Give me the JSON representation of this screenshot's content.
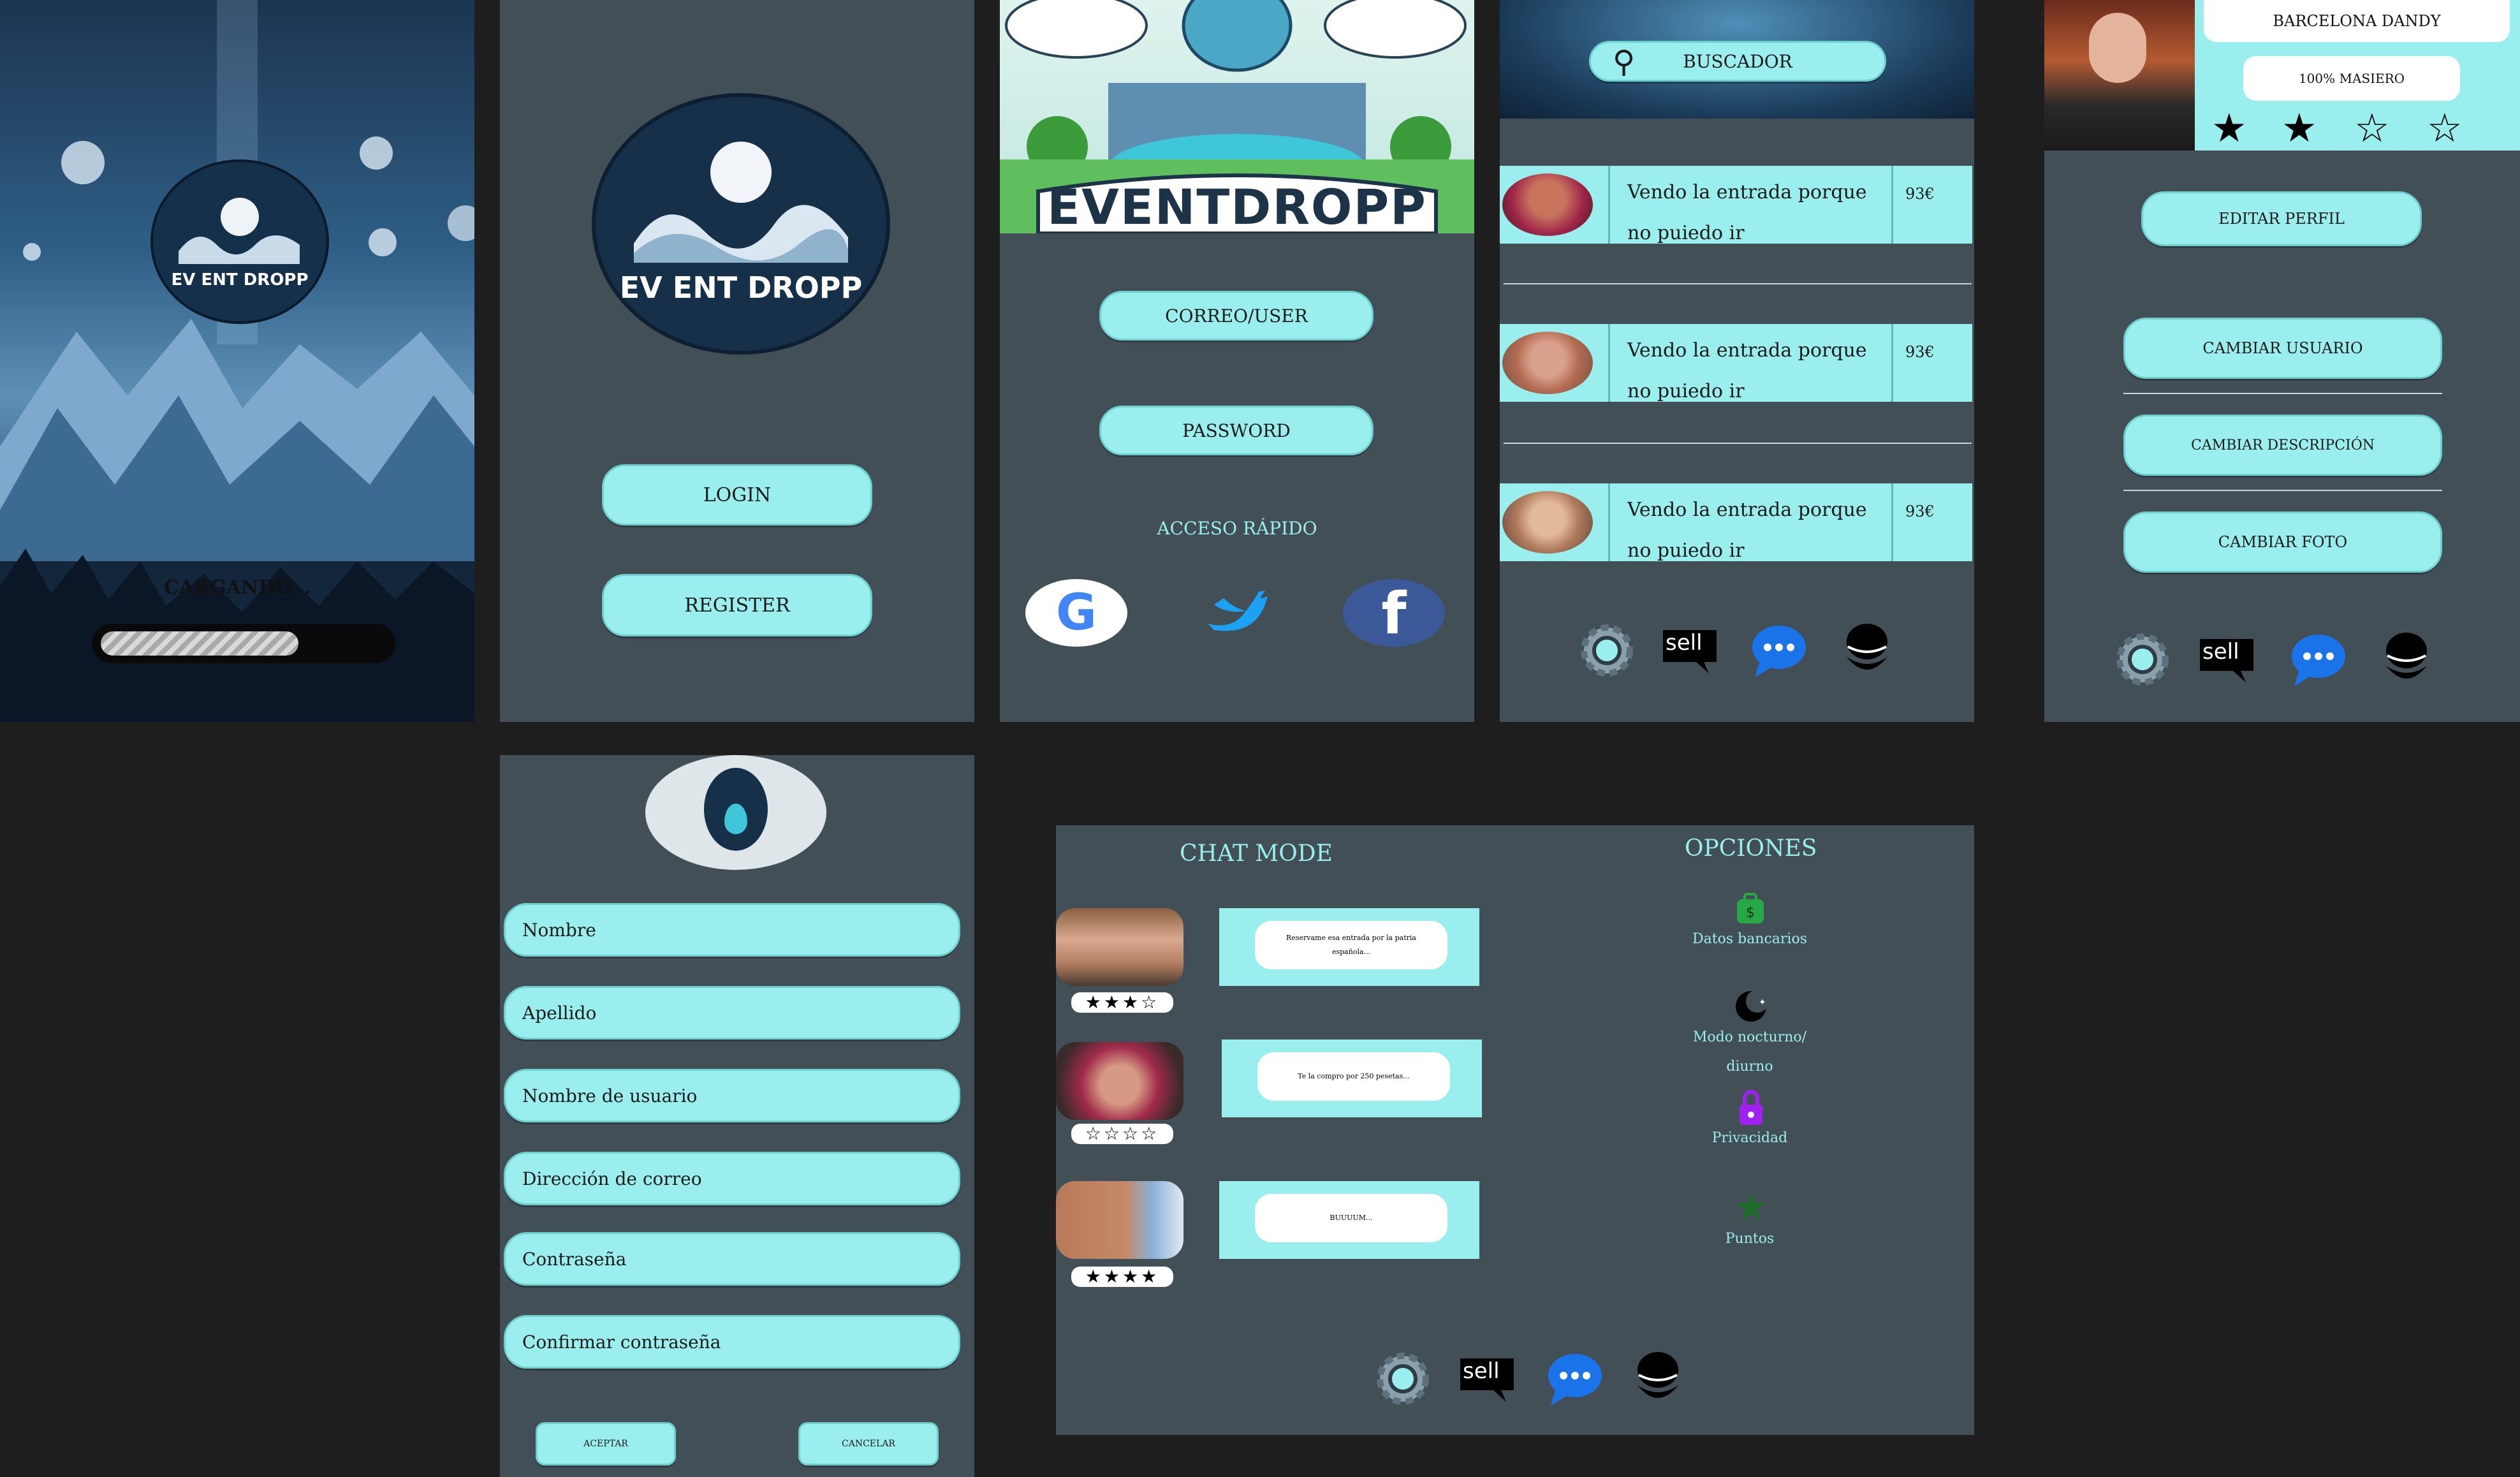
{
  "loading": {
    "brand": "EV ENT DROPP",
    "text": "CARGANDO..."
  },
  "welcome": {
    "brand": "EV ENT DROPP",
    "login": "LOGIN",
    "register": "REGISTER"
  },
  "login": {
    "brand": "EVENTDROPP",
    "user_field": "CORREO/USER",
    "password_field": "PASSWORD",
    "quick_access": "ACCESO RÁPIDO"
  },
  "search": {
    "search_button": "BUSCADOR",
    "listings": [
      {
        "text": "Vendo la entrada porque no puiedo ir",
        "price": "93€"
      },
      {
        "text": "Vendo la entrada porque no puiedo ir",
        "price": "93€"
      },
      {
        "text": "Vendo la entrada porque no puiedo ir",
        "price": "93€"
      }
    ]
  },
  "profile": {
    "name": "BARCELONA DANDY",
    "tag": "100% MASIERO",
    "rating": 2,
    "rating_max": 4,
    "edit": "EDITAR PERFIL",
    "change_user": "CAMBIAR USUARIO",
    "change_desc": "CAMBIAR DESCRIPCIÓN",
    "change_photo": "CAMBIAR FOTO"
  },
  "nav": {
    "sell_label": "sell"
  },
  "register": {
    "fields": [
      "Nombre",
      "Apellido",
      "Nombre de usuario",
      "Dirección de correo",
      "Contraseña",
      "Confirmar contraseña"
    ],
    "accept": "ACEPTAR",
    "cancel": "CANCELAR"
  },
  "chat": {
    "title": "CHAT MODE",
    "messages": [
      {
        "text": "Reservame esa entrada por la patria española...",
        "rating": "★★★☆"
      },
      {
        "text": "Te la compro por 250 pesetas...",
        "rating": "☆☆☆☆"
      },
      {
        "text": "BUUUUM...",
        "rating": "★★★★"
      }
    ]
  },
  "options": {
    "title": "OPCIONES",
    "items": [
      "Datos bancarios",
      "Modo nocturno/ diurno",
      "Privacidad",
      "Puntos"
    ]
  },
  "colors": {
    "accent": "#9aeeed",
    "panel": "#434f57",
    "background": "#1e1e1e"
  }
}
